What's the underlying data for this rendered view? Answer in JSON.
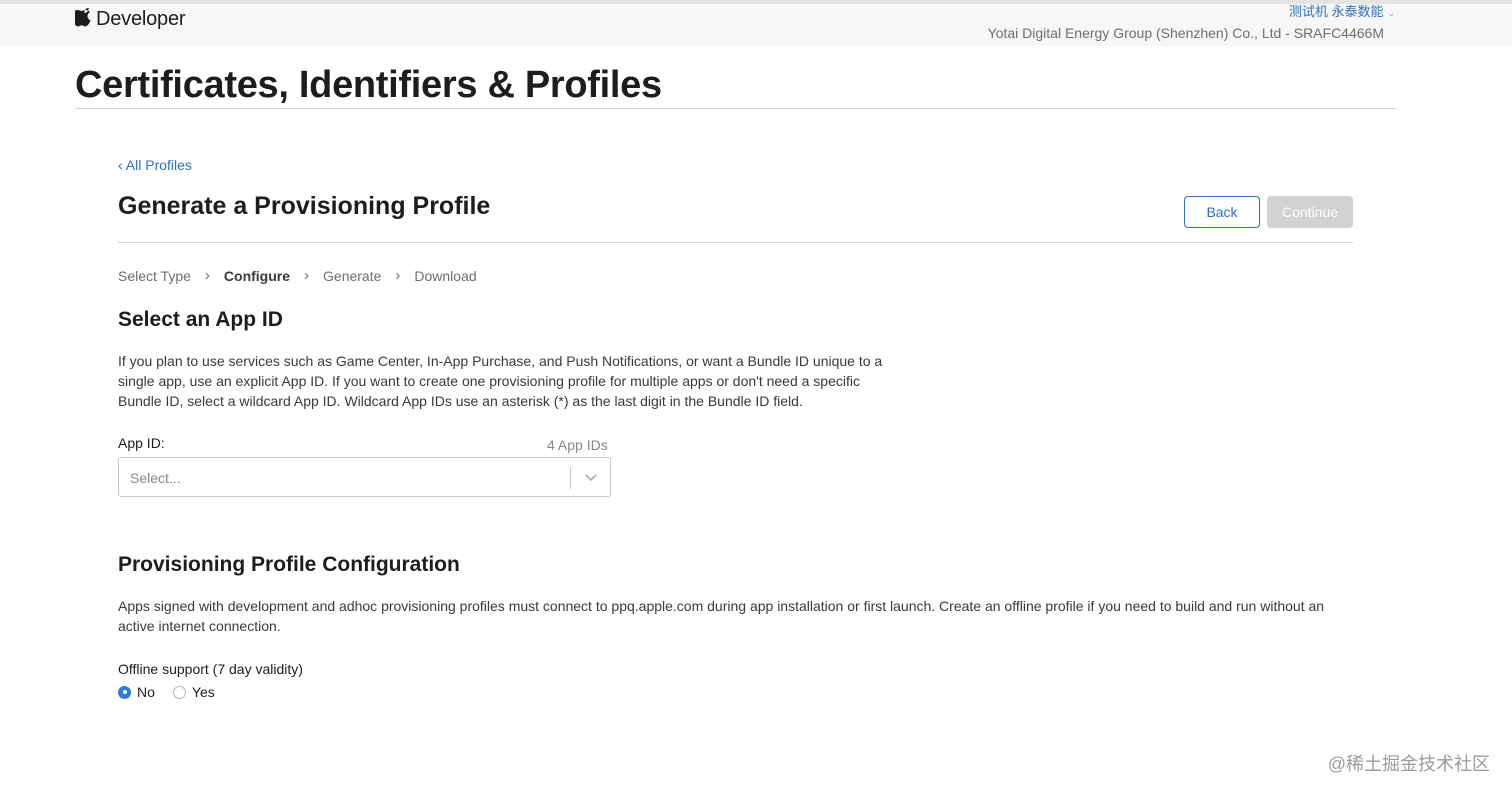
{
  "header": {
    "brand": "Developer",
    "account_name": "测试机 永泰数能",
    "team_name": "Yotai Digital Energy Group (Shenzhen) Co., Ltd - SRAFC4466M"
  },
  "page": {
    "title": "Certificates, Identifiers & Profiles",
    "back_link": "‹ All Profiles",
    "section_title": "Generate a Provisioning Profile",
    "back_button": "Back",
    "continue_button": "Continue"
  },
  "steps": [
    {
      "label": "Select Type",
      "active": false
    },
    {
      "label": "Configure",
      "active": true
    },
    {
      "label": "Generate",
      "active": false
    },
    {
      "label": "Download",
      "active": false
    }
  ],
  "select_app_id": {
    "heading": "Select an App ID",
    "description": "If you plan to use services such as Game Center, In-App Purchase, and Push Notifications, or want a Bundle ID unique to a single app, use an explicit App ID. If you want to create one provisioning profile for multiple apps or don't need a specific Bundle ID, select a wildcard App ID. Wildcard App IDs use an asterisk (*) as the last digit in the Bundle ID field.",
    "field_label": "App ID:",
    "count": "4 App IDs",
    "placeholder": "Select..."
  },
  "configuration": {
    "heading": "Provisioning Profile Configuration",
    "description": "Apps signed with development and adhoc provisioning profiles must connect to ppq.apple.com during app installation or first launch. Create an offline profile if you need to build and run without an active internet connection.",
    "offline_label": "Offline support (7 day validity)",
    "options": [
      {
        "label": "No",
        "checked": true
      },
      {
        "label": "Yes",
        "checked": false
      }
    ]
  },
  "watermark": "@稀土掘金技术社区",
  "colors": {
    "accent": "#2f6fbf",
    "disabled_button": "#d2d2d2",
    "radio_checked": "#2f7bd9"
  }
}
